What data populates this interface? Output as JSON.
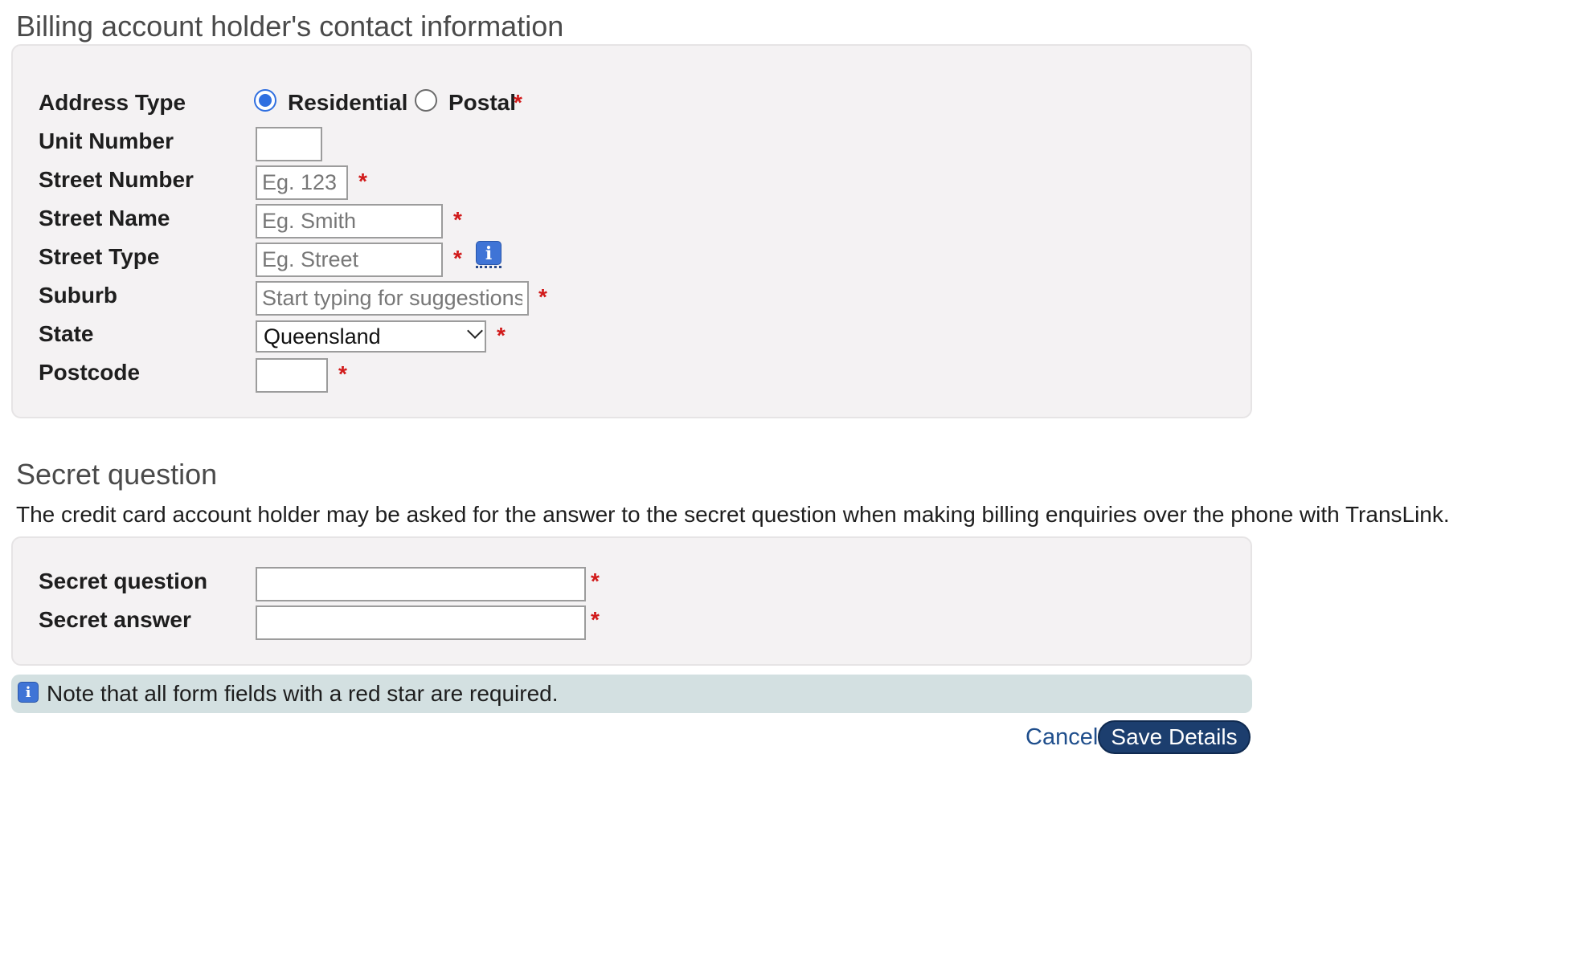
{
  "address_section": {
    "title": "Billing account holder's contact information",
    "address_type": {
      "label": "Address Type",
      "options": [
        "Residential",
        "Postal"
      ],
      "selected": "Residential"
    },
    "unit_number": {
      "label": "Unit Number",
      "value": "",
      "placeholder": ""
    },
    "street_number": {
      "label": "Street Number",
      "value": "",
      "placeholder": "Eg. 123"
    },
    "street_name": {
      "label": "Street Name",
      "value": "",
      "placeholder": "Eg. Smith"
    },
    "street_type": {
      "label": "Street Type",
      "value": "",
      "placeholder": "Eg. Street",
      "info_icon": "info-icon"
    },
    "suburb": {
      "label": "Suburb",
      "value": "",
      "placeholder": "Start typing for suggestions..."
    },
    "state": {
      "label": "State",
      "selected": "Queensland"
    },
    "postcode": {
      "label": "Postcode",
      "value": "",
      "placeholder": ""
    },
    "required_mark": "*"
  },
  "secret_section": {
    "title": "Secret question",
    "description": "The credit card account holder may be asked for the answer to the secret question when making billing enquiries over the phone with TransLink.",
    "secret_question": {
      "label": "Secret question",
      "value": ""
    },
    "secret_answer": {
      "label": "Secret answer",
      "value": ""
    }
  },
  "note": {
    "icon": "info-icon",
    "text": "Note that all form fields with a red star are required."
  },
  "actions": {
    "cancel_label": "Cancel",
    "save_label": "Save Details"
  },
  "colors": {
    "panel_bg": "#f4f2f3",
    "note_bg": "#d3e0e1",
    "required": "#d11a1a",
    "primary_button": "#1c3e6e",
    "link": "#1f4e8c",
    "radio_selected": "#2f6fe0"
  }
}
